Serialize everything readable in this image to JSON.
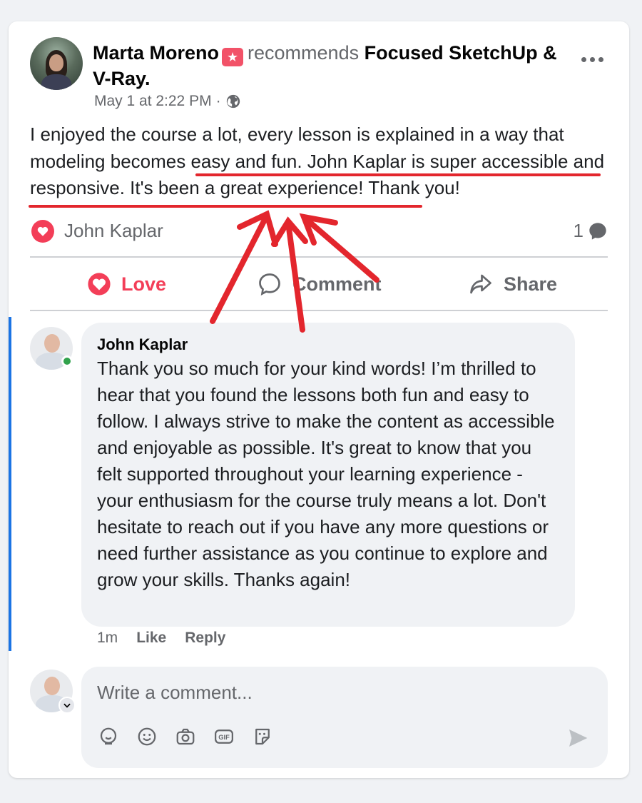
{
  "post": {
    "author": "Marta Moreno",
    "verb": "recommends",
    "page": "Focused SketchUp & V-Ray.",
    "timestamp": "May 1 at 2:22 PM",
    "meta_separator": "·",
    "body": "I enjoyed the course a lot, every lesson is explained in a way that modeling becomes easy and fun. John Kaplar is super accessible and responsive. It's been a great experience! Thank you!"
  },
  "reactions": {
    "reactor": "John Kaplar",
    "comment_count": "1"
  },
  "actions": {
    "love": "Love",
    "comment": "Comment",
    "share": "Share"
  },
  "comment": {
    "author": "John Kaplar",
    "text": "Thank you so much for your kind words! I’m thrilled to hear that you found the lessons both fun and easy to follow. I always strive to make the content as accessible and enjoyable as possible. It's great to know that you felt supported throughout your learning experience - your enthusiasm for the course truly means a lot. Don't hesitate to reach out if you have any more questions or need further assistance as you continue to explore and grow your skills. Thanks again!",
    "time": "1m",
    "like": "Like",
    "reply": "Reply"
  },
  "composer": {
    "placeholder": "Write a comment..."
  },
  "icons": {
    "badge": "top-fan-badge-icon",
    "privacy": "globe-icon",
    "reaction": "love-reaction-icon",
    "comment_count": "comment-bubble-icon",
    "tools": [
      "avatar-sticker-icon",
      "emoji-icon",
      "camera-icon",
      "gif-icon",
      "sticker-icon"
    ],
    "send": "send-icon"
  },
  "colors": {
    "love": "#f33e58",
    "online": "#31a24c",
    "thread_bar": "#1b74e4",
    "annotation": "#e3262d"
  }
}
